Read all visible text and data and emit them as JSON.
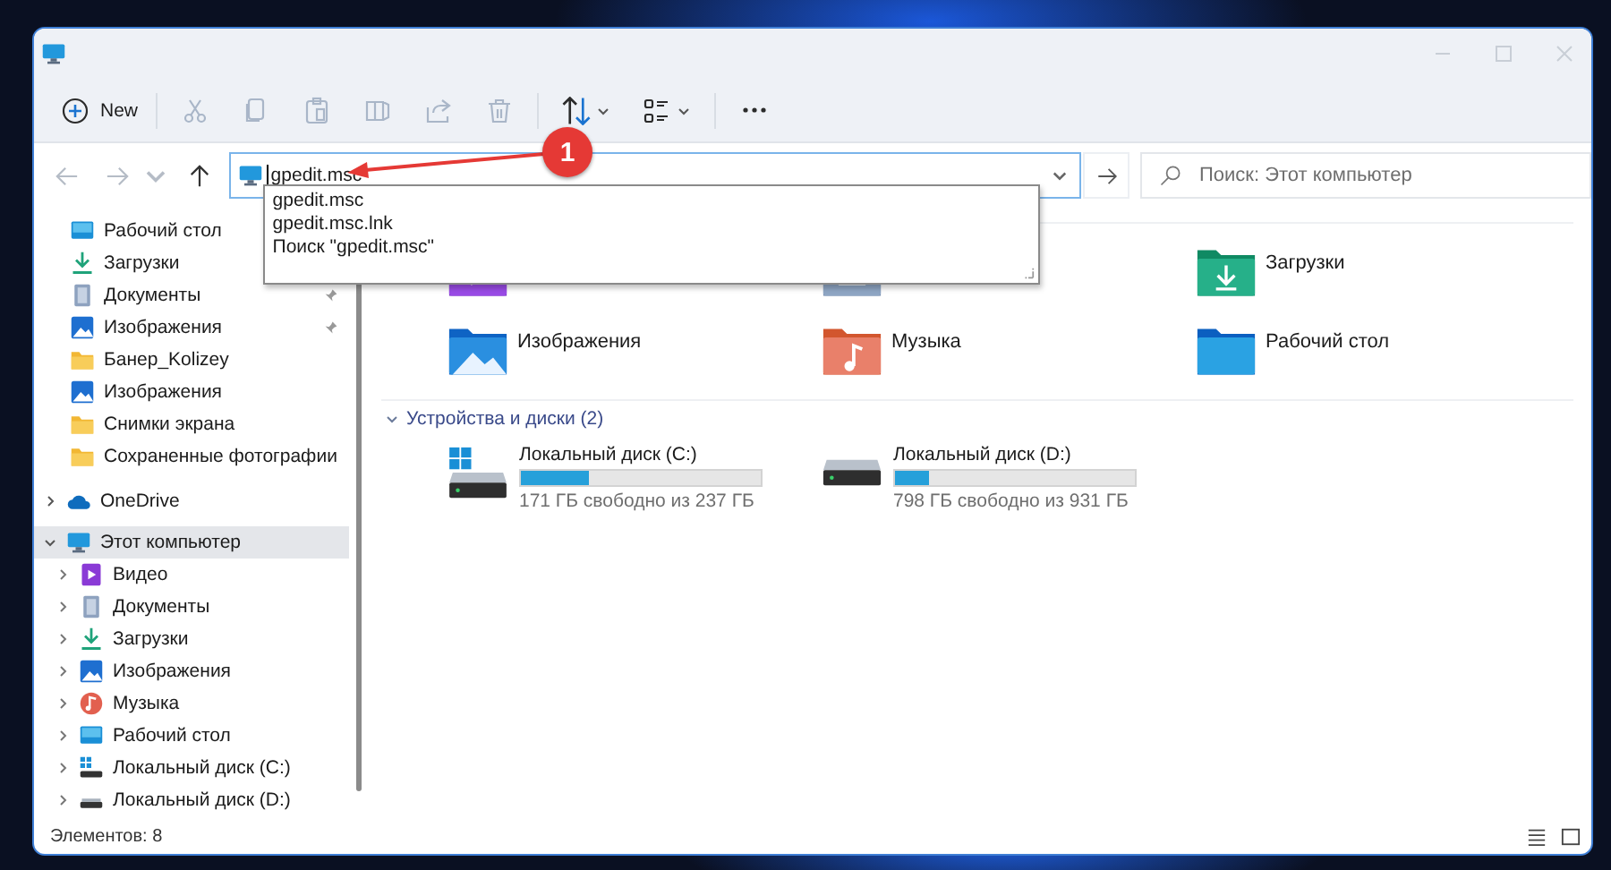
{
  "toolbar": {
    "new_label": "New",
    "tool_groups": [
      [
        {
          "kind": "cut",
          "disabled": true
        },
        {
          "kind": "copy",
          "disabled": true
        },
        {
          "kind": "paste",
          "disabled": true
        },
        {
          "kind": "rename",
          "disabled": true
        },
        {
          "kind": "share",
          "disabled": true
        },
        {
          "kind": "delete",
          "disabled": true
        }
      ],
      [
        {
          "kind": "sort",
          "disabled": false
        },
        {
          "kind": "view",
          "disabled": false
        }
      ],
      [
        {
          "kind": "more"
        }
      ]
    ]
  },
  "navigation": [
    {
      "kind": "back",
      "disabled": true
    },
    {
      "kind": "forward",
      "disabled": true
    },
    {
      "kind": "recent",
      "disabled": true
    },
    {
      "kind": "up",
      "disabled": false
    }
  ],
  "address": {
    "value": "gpedit.msc",
    "suggestions": [
      "gpedit.msc",
      "gpedit.msc.lnk",
      "Поиск \"gpedit.msc\""
    ]
  },
  "search": {
    "placeholder": "Поиск: Этот компьютер"
  },
  "annotation": {
    "number": "1"
  },
  "sidebar": {
    "quick_access": [
      {
        "label": "Рабочий стол",
        "kind": "desktop",
        "pinned": false
      },
      {
        "label": "Загрузки",
        "kind": "downloads",
        "pinned": false
      },
      {
        "label": "Документы",
        "kind": "documents",
        "pinned": true
      },
      {
        "label": "Изображения",
        "kind": "pictures",
        "pinned": true
      },
      {
        "label": "Банер_Kolizey",
        "kind": "folder",
        "pinned": false
      },
      {
        "label": "Изображения",
        "kind": "pictures",
        "pinned": false
      },
      {
        "label": "Снимки экрана",
        "kind": "folder",
        "pinned": false
      },
      {
        "label": "Сохраненные фотографии",
        "kind": "folder",
        "pinned": false
      }
    ],
    "items": [
      {
        "label": "OneDrive",
        "kind": "onedrive",
        "expanded": false,
        "selected": false
      },
      {
        "label": "Этот компьютер",
        "kind": "computer",
        "expanded": true,
        "selected": true,
        "children": [
          {
            "label": "Видео",
            "kind": "video"
          },
          {
            "label": "Документы",
            "kind": "documents"
          },
          {
            "label": "Загрузки",
            "kind": "downloads"
          },
          {
            "label": "Изображения",
            "kind": "pictures"
          },
          {
            "label": "Музыка",
            "kind": "music"
          },
          {
            "label": "Рабочий стол",
            "kind": "desktop"
          },
          {
            "label": "Локальный диск (C:)",
            "kind": "drive-system"
          },
          {
            "label": "Локальный диск (D:)",
            "kind": "drive"
          }
        ]
      }
    ]
  },
  "folders": [
    {
      "kind": "video"
    },
    {
      "kind": "documents"
    },
    {
      "kind": "downloads",
      "name": "Загрузки"
    },
    {
      "kind": "pictures",
      "name": "Изображения"
    },
    {
      "kind": "music",
      "name": "Музыка"
    },
    {
      "kind": "desktop",
      "name": "Рабочий стол"
    }
  ],
  "drives_section": {
    "title": "Устройства и диски (2)",
    "expanded": true
  },
  "drives": [
    {
      "kind": "system",
      "name": "Локальный диск (C:)",
      "level": 0.28,
      "free": "171 ГБ свободно из 237 ГБ"
    },
    {
      "kind": "data",
      "name": "Локальный диск (D:)",
      "level": 0.14,
      "free": "798 ГБ свободно из 931 ГБ"
    }
  ],
  "status_bar": {
    "count": "Элементов: 8"
  }
}
